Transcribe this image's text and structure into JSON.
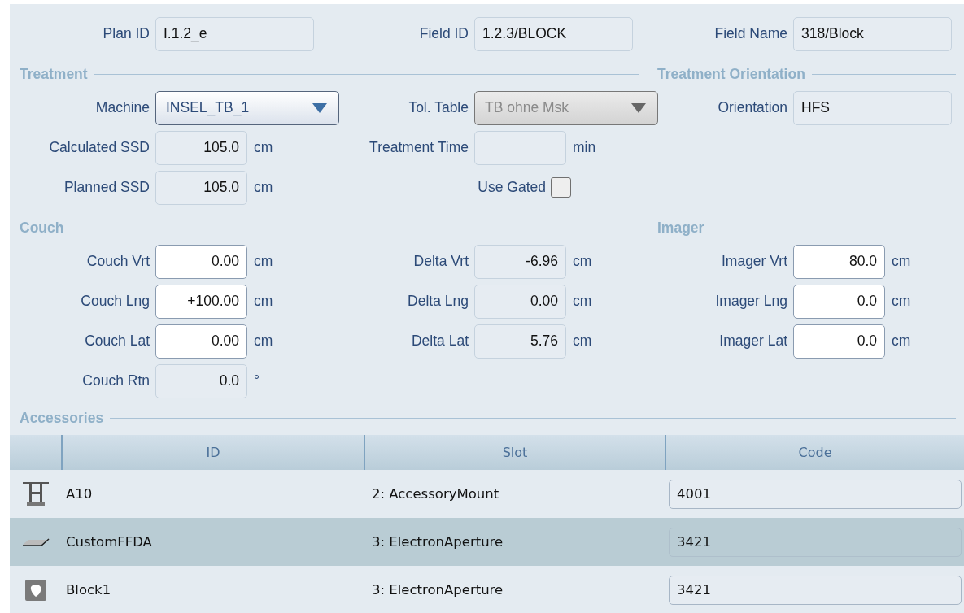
{
  "ids": [
    {
      "kind": "text",
      "label": "Plan ID",
      "value": "I.1.2_e",
      "editable": false
    },
    {
      "kind": "text",
      "label": "Field ID",
      "value": "1.2.3/BLOCK",
      "editable": false
    },
    {
      "kind": "text",
      "label": "Field Name",
      "value": "318/Block",
      "editable": false
    }
  ],
  "treatment": {
    "title": "Treatment",
    "column_1": [
      {
        "kind": "dropdown",
        "label": "Machine",
        "value": "INSEL_TB_1",
        "disabled": false
      },
      {
        "kind": "number",
        "label": "Calculated SSD",
        "value": "105.0",
        "unit": "cm",
        "editable": false
      },
      {
        "kind": "number",
        "label": "Planned SSD",
        "value": "105.0",
        "unit": "cm",
        "editable": false
      }
    ],
    "column_2": [
      {
        "kind": "dropdown",
        "label": "Tol. Table",
        "value": "TB ohne Msk",
        "disabled": true
      },
      {
        "kind": "number",
        "label": "Treatment Time",
        "unit": "min",
        "editable": false
      },
      {
        "kind": "checkbox",
        "label": "Use Gated",
        "checked": false
      }
    ]
  },
  "treatment_orientation": {
    "title": "Treatment Orientation",
    "fields": [
      {
        "kind": "text",
        "label": "Orientation",
        "value": "HFS",
        "editable": false
      }
    ]
  },
  "couch": {
    "title": "Couch",
    "column_1": [
      {
        "kind": "number",
        "label": "Couch Vrt",
        "value": "0.00",
        "unit": "cm",
        "editable": true
      },
      {
        "kind": "number",
        "label": "Couch Lng",
        "value": "+100.00",
        "unit": "cm",
        "editable": true
      },
      {
        "kind": "number",
        "label": "Couch Lat",
        "value": "0.00",
        "unit": "cm",
        "editable": true
      },
      {
        "kind": "number",
        "label": "Couch Rtn",
        "value": "0.0",
        "unit": "°",
        "editable": false
      }
    ],
    "column_2": [
      {
        "kind": "number",
        "label": "Delta Vrt",
        "value": "-6.96",
        "unit": "cm",
        "editable": false
      },
      {
        "kind": "number",
        "label": "Delta Lng",
        "value": "0.00",
        "unit": "cm",
        "editable": false
      },
      {
        "kind": "number",
        "label": "Delta Lat",
        "value": "5.76",
        "unit": "cm",
        "editable": false
      }
    ]
  },
  "imager": {
    "title": "Imager",
    "fields": [
      {
        "kind": "number",
        "label": "Imager Vrt",
        "value": "80.0",
        "unit": "cm",
        "editable": true
      },
      {
        "kind": "number",
        "label": "Imager Lng",
        "value": "0.0",
        "unit": "cm",
        "editable": true
      },
      {
        "kind": "number",
        "label": "Imager Lat",
        "value": "0.0",
        "unit": "cm",
        "editable": true
      }
    ]
  },
  "accessories": {
    "title": "Accessories",
    "columns": [
      "ID",
      "Slot",
      "Code"
    ],
    "rows": [
      {
        "kind": "mount",
        "id": "A10",
        "slot": "2: AccessoryMount",
        "code": "4001",
        "selected": false
      },
      {
        "kind": "tray",
        "id": "CustomFFDA",
        "slot": "3: ElectronAperture",
        "code": "3421",
        "selected": true
      },
      {
        "kind": "block",
        "id": "Block1",
        "slot": "3: ElectronAperture",
        "code": "3421",
        "selected": false
      }
    ]
  }
}
